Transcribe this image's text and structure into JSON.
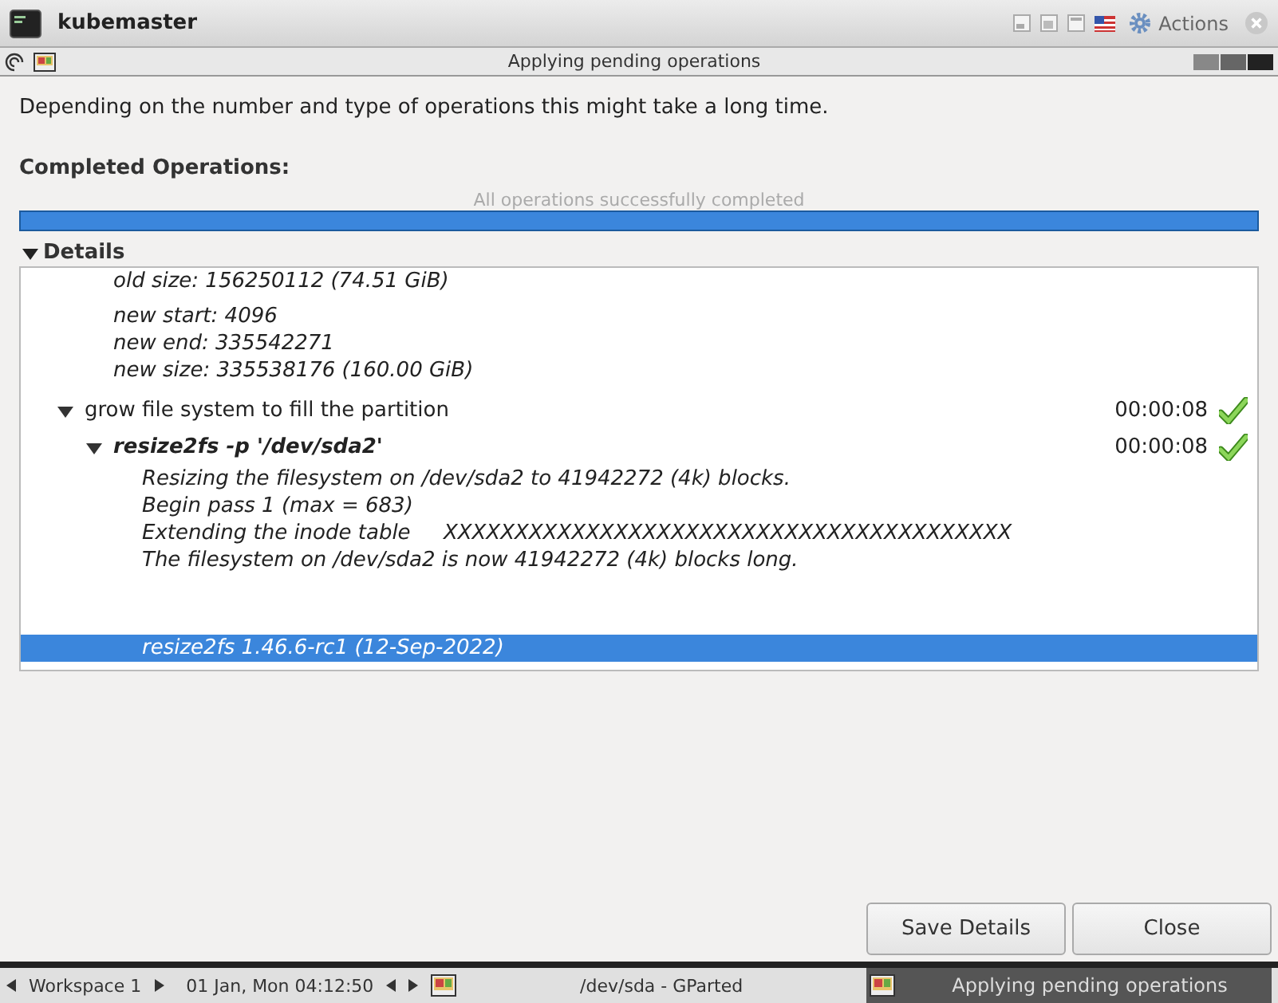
{
  "window": {
    "title": "kubemaster",
    "actions_label": "Actions"
  },
  "dialog": {
    "title": "Applying pending operations"
  },
  "intro": "Depending on the number and type of operations this might take a long time.",
  "completed": {
    "heading": "Completed Operations:",
    "status": "All operations successfully completed",
    "level": 1
  },
  "details": {
    "label": "Details",
    "expanded": true,
    "tree": [
      {
        "children": [
          {
            "kind": "output",
            "lines": [
              "old size: 156250112 (74.51 GiB)"
            ],
            "selected": false
          },
          {
            "kind": "output",
            "lines": [
              "new start: 4096",
              "new end: 335542271",
              "new size: 335538176 (160.00 GiB)"
            ],
            "selected": false
          }
        ]
      },
      {
        "kind": "step",
        "text": "grow file system to fill the partition",
        "time": "00:00:08",
        "succeeded": true,
        "expanded": true,
        "children": [
          {
            "kind": "command",
            "text": "resize2fs -p '/dev/sda2'",
            "time": "00:00:08",
            "succeeded": true,
            "expanded": true,
            "children": [
              {
                "kind": "output",
                "lines": [
                  "Resizing the filesystem on /dev/sda2 to 41942272 (4k) blocks.",
                  "Begin pass 1 (max = 683)",
                  "Extending the inode table     XXXXXXXXXXXXXXXXXXXXXXXXXXXXXXXXXXXXXXXX",
                  "The filesystem on /dev/sda2 is now 41942272 (4k) blocks long."
                ],
                "selected": false
              },
              {
                "kind": "output",
                "lines": [
                  "resize2fs 1.46.6-rc1 (12-Sep-2022)"
                ],
                "selected": true
              }
            ]
          }
        ]
      }
    ]
  },
  "buttons": [
    {
      "label": "Save Details"
    },
    {
      "label": "Close"
    }
  ],
  "taskbar": {
    "workspace": "Workspace 1",
    "clock": "01 Jan, Mon 04:12:50",
    "window_title": "/dev/sda - GParted",
    "task": "Applying pending operations"
  }
}
